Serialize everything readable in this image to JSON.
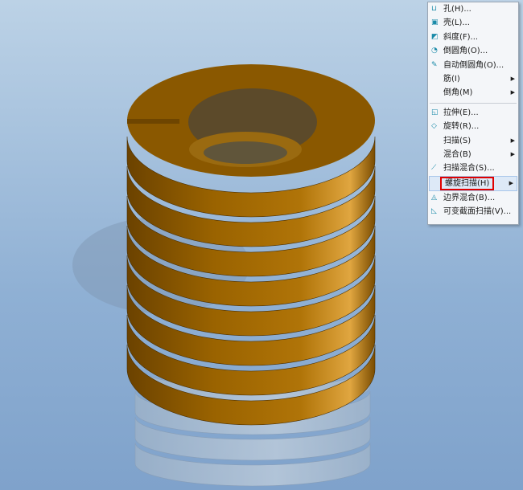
{
  "colors": {
    "spring": "#8a5600",
    "highlight": "#e00000"
  },
  "menu": {
    "group1": [
      {
        "label": "孔(H)...",
        "icon": "hole-icon",
        "submenu": false
      },
      {
        "label": "壳(L)...",
        "icon": "shell-icon",
        "submenu": false
      },
      {
        "label": "斜度(F)...",
        "icon": "draft-icon",
        "submenu": false
      },
      {
        "label": "倒圆角(O)...",
        "icon": "round-icon",
        "submenu": false
      },
      {
        "label": "自动倒圆角(O)...",
        "icon": "auto-round-icon",
        "submenu": false
      },
      {
        "label": "筋(I)",
        "icon": "",
        "submenu": true
      },
      {
        "label": "倒角(M)",
        "icon": "",
        "submenu": true
      }
    ],
    "group2": [
      {
        "label": "拉伸(E)...",
        "icon": "extrude-icon",
        "submenu": false
      },
      {
        "label": "旋转(R)...",
        "icon": "revolve-icon",
        "submenu": false
      },
      {
        "label": "扫描(S)",
        "icon": "",
        "submenu": true
      },
      {
        "label": "混合(B)",
        "icon": "",
        "submenu": true
      },
      {
        "label": "扫描混合(S)...",
        "icon": "swept-blend-icon",
        "submenu": false
      },
      {
        "label": "螺旋扫描(H)",
        "icon": "",
        "submenu": true,
        "highlighted": true
      },
      {
        "label": "边界混合(B)...",
        "icon": "boundary-blend-icon",
        "submenu": false
      },
      {
        "label": "可变截面扫描(V)...",
        "icon": "variable-sweep-icon",
        "submenu": false
      }
    ]
  }
}
